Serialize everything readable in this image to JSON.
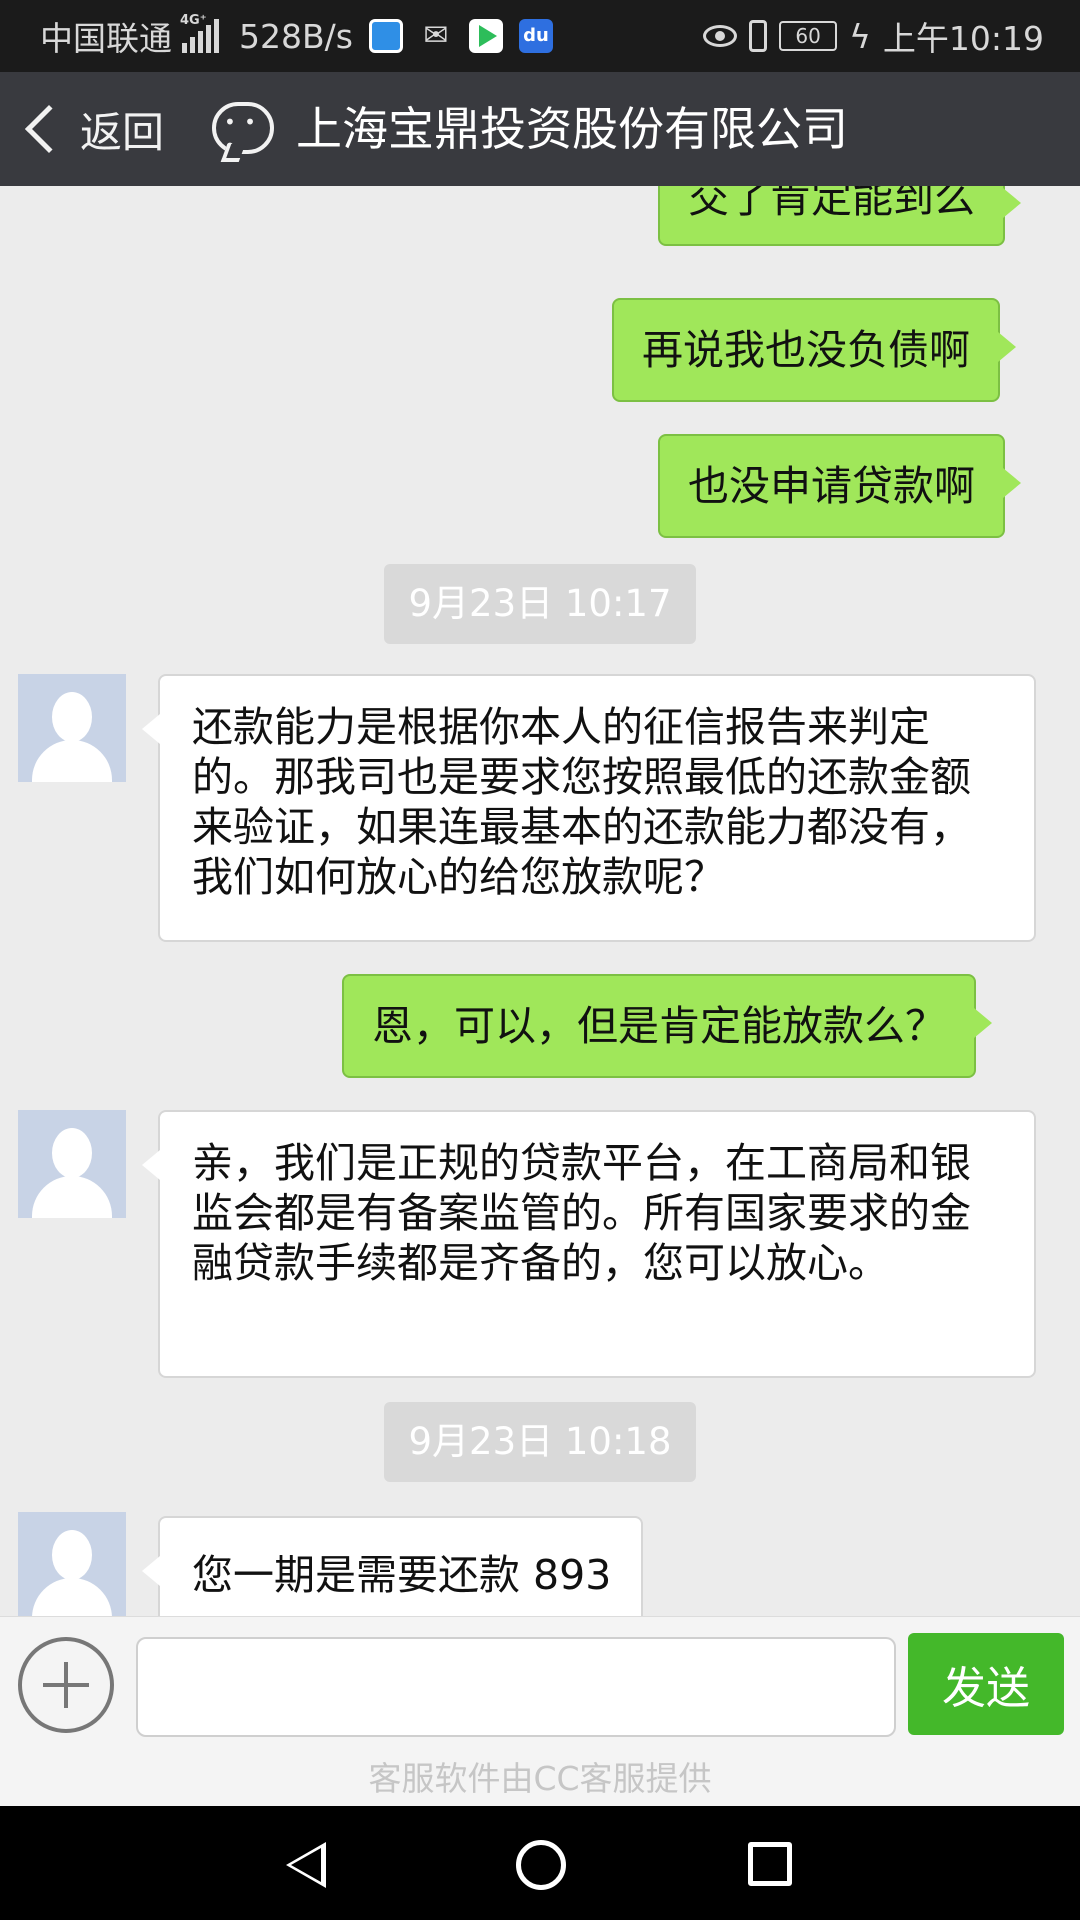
{
  "status_bar": {
    "carrier": "中国联通",
    "network_type": "4G⁺",
    "speed": "528B/s",
    "battery": "60",
    "time": "上午10:19",
    "app_icons": [
      "clock-app-icon",
      "wechat-icon",
      "video-app-icon",
      "baidu-icon"
    ]
  },
  "header": {
    "back_label": "返回",
    "title": "上海宝鼎投资股份有限公司"
  },
  "messages": [
    {
      "type": "out",
      "text": "交了肯定能到么"
    },
    {
      "type": "out",
      "text": "再说我也没负债啊"
    },
    {
      "type": "out",
      "text": "也没申请贷款啊"
    },
    {
      "type": "time",
      "text": "9月23日 10:17"
    },
    {
      "type": "in",
      "text": "还款能力是根据你本人的征信报告来判定的。那我司也是要求您按照最低的还款金额来验证，如果连最基本的还款能力都没有，我们如何放心的给您放款呢？"
    },
    {
      "type": "out",
      "text": "恩，可以，但是肯定能放款么？"
    },
    {
      "type": "in",
      "text": "亲，我们是正规的贷款平台，在工商局和银监会都是有备案监管的。所有国家要求的金融贷款手续都是齐备的，您可以放心。"
    },
    {
      "type": "time",
      "text": "9月23日 10:18"
    },
    {
      "type": "in",
      "text": "您一期是需要还款 893"
    }
  ],
  "input_bar": {
    "input_value": "",
    "send_label": "发送"
  },
  "footer_note": "客服软件由CC客服提供",
  "colors": {
    "outgoing_bubble": "#a0e75a",
    "incoming_bubble": "#ffffff",
    "title_bar": "#393a3f",
    "send_button": "#44b82a"
  }
}
